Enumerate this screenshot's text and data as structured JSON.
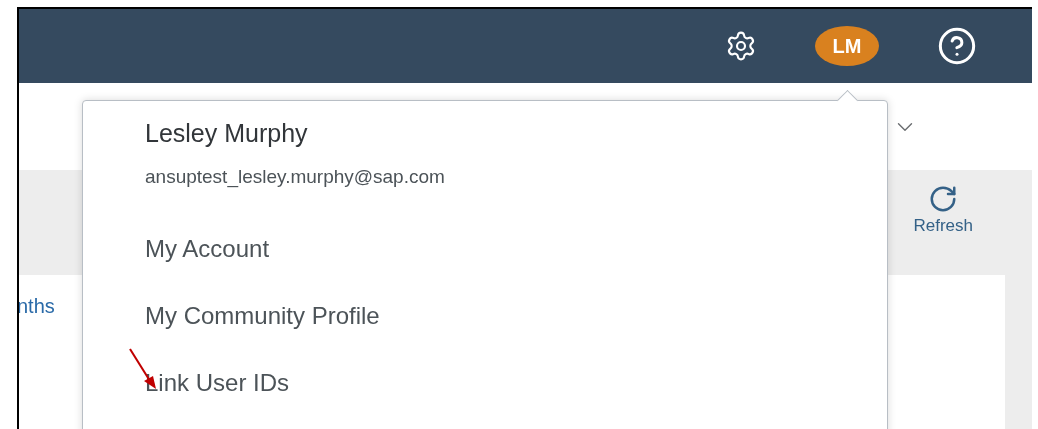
{
  "header": {
    "avatar_initials": "LM"
  },
  "popover": {
    "name": "Lesley Murphy",
    "email": "ansuptest_lesley.murphy@sap.com",
    "items": [
      "My Account",
      "My Community Profile",
      "Link User IDs"
    ]
  },
  "toolbar": {
    "refresh_label": "Refresh"
  },
  "content": {
    "link_text": "nths"
  }
}
